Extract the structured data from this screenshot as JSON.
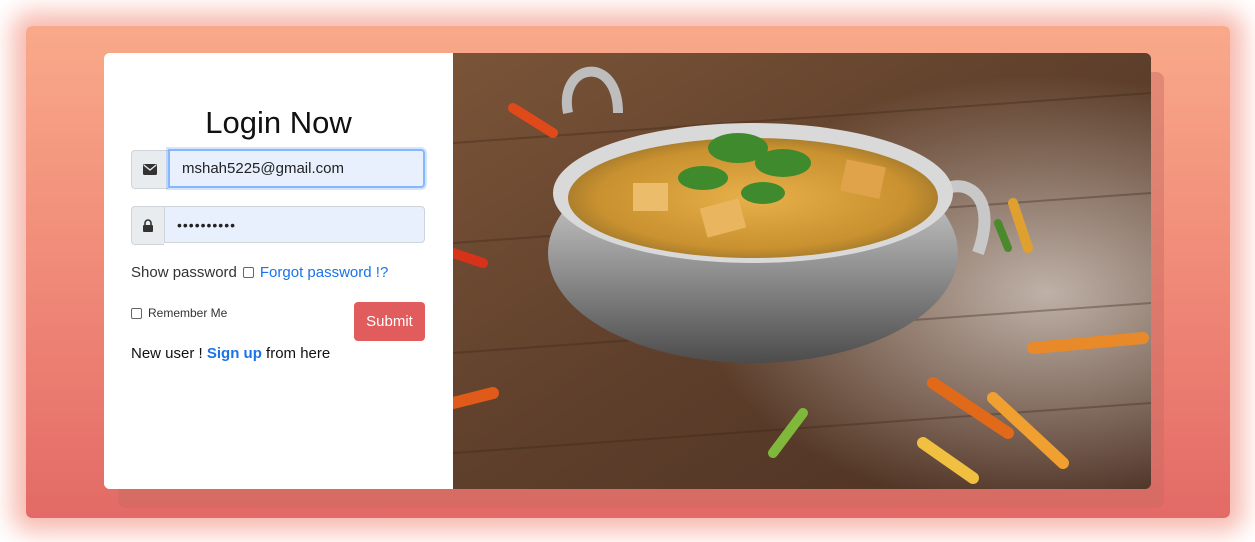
{
  "login": {
    "title": "Login Now",
    "email_value": "mshah5225@gmail.com",
    "password_value": "••••••••••",
    "show_password_label": "Show password",
    "forgot_password_label": "Forgot password !?",
    "remember_me_label": "Remember Me",
    "submit_label": "Submit",
    "new_user_prefix": "New user !",
    "sign_up_label": "Sign up",
    "new_user_suffix": "from here"
  },
  "icons": {
    "email": "envelope-icon",
    "password": "lock-icon"
  },
  "colors": {
    "accent_link": "#1a73e8",
    "submit_bg": "#e15c5c",
    "backdrop_top": "#f9a98a",
    "backdrop_bottom": "#e36a66"
  }
}
